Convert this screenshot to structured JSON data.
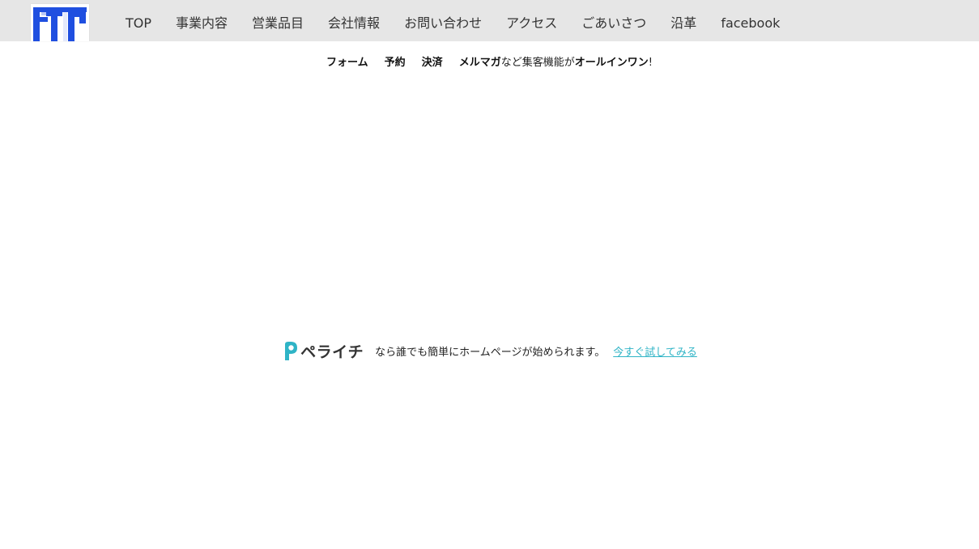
{
  "header": {
    "logo_text": "FTC",
    "nav": [
      {
        "label": "TOP"
      },
      {
        "label": "事業内容"
      },
      {
        "label": "営業品目"
      },
      {
        "label": "会社情報"
      },
      {
        "label": "お問い合わせ"
      },
      {
        "label": "アクセス"
      },
      {
        "label": "ごあいさつ"
      },
      {
        "label": "沿革"
      },
      {
        "label": "facebook"
      }
    ]
  },
  "banner": {
    "form": "フォーム",
    "reserve": "予約",
    "payment": "決済",
    "mailmag": "メルマガ",
    "middle": "など集客機能が",
    "allinone": "オールインワン",
    "end": "!"
  },
  "promo": {
    "brand": "ペライチ",
    "text": "なら誰でも簡単にホームページが始められます。",
    "cta": "今すぐ試してみる"
  },
  "colors": {
    "topbar": "#e6e6e6",
    "logo_blue": "#1f4fe0",
    "accent": "#2fb4c6"
  }
}
